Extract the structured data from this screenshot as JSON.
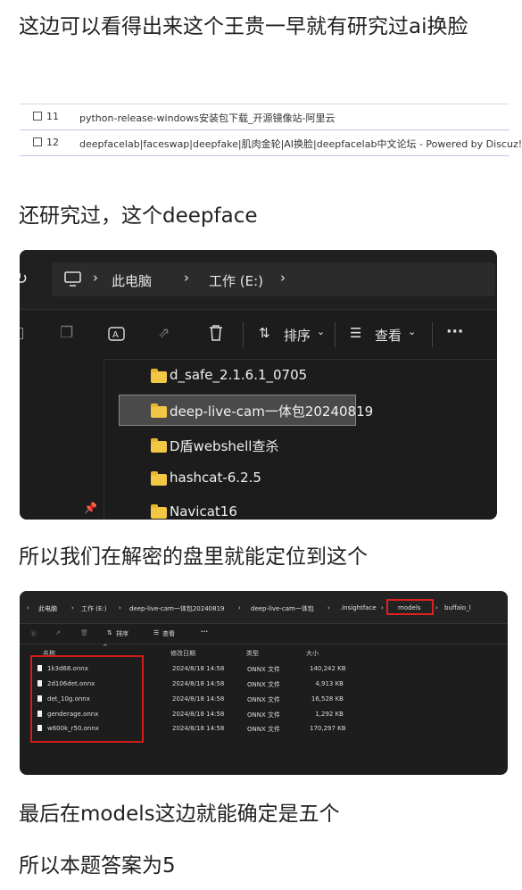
{
  "paragraphs": {
    "p1": "这边可以看得出来这个王贵一早就有研究过ai换脸",
    "p2": "还研究过，这个deepface",
    "p3": "所以我们在解密的盘里就能定位到这个",
    "p4": "最后在models这边就能确定是五个",
    "p5": "所以本题答案为5"
  },
  "history": [
    {
      "num": "11",
      "text": "python-release-windows安装包下载_开源镜像站-阿里云"
    },
    {
      "num": "12",
      "text": "deepfacelab|faceswap|deepfake|肌肉金轮|AI换脸|deepfacelab中文论坛 - Powered by Discuz!"
    }
  ],
  "explorer1": {
    "breadcrumb": [
      "此电脑",
      "工作 (E:)"
    ],
    "toolbar": {
      "sort": "排序",
      "view": "查看",
      "more": "···"
    },
    "folders": [
      "d_safe_2.1.6.1_0705",
      "deep-live-cam一体包20240819",
      "D盾webshell查杀",
      "hashcat-6.2.5",
      "Navicat16"
    ],
    "selected_index": 1
  },
  "explorer2": {
    "breadcrumb": [
      "此电脑",
      "工作 (E:)",
      "deep-live-cam一体包20240819",
      "deep-live-cam一体包",
      ".insightface",
      "models",
      "buffalo_l"
    ],
    "toolbar": {
      "sort": "排序",
      "view": "查看",
      "more": "···"
    },
    "columns": [
      "名称",
      "修改日期",
      "类型",
      "大小"
    ],
    "files": [
      {
        "name": "1k3d68.onnx",
        "date": "2024/8/18 14:58",
        "type": "ONNX 文件",
        "size": "140,242 KB"
      },
      {
        "name": "2d106det.onnx",
        "date": "2024/8/18 14:58",
        "type": "ONNX 文件",
        "size": "4,913 KB"
      },
      {
        "name": "det_10g.onnx",
        "date": "2024/8/18 14:58",
        "type": "ONNX 文件",
        "size": "16,528 KB"
      },
      {
        "name": "genderage.onnx",
        "date": "2024/8/18 14:58",
        "type": "ONNX 文件",
        "size": "1,292 KB"
      },
      {
        "name": "w600k_r50.onnx",
        "date": "2024/8/18 14:58",
        "type": "ONNX 文件",
        "size": "170,297 KB"
      }
    ]
  },
  "colors": {
    "highlight_red": "#d21c1c",
    "folder_yellow": "#f3c744",
    "dark_bg": "#1c1c1c"
  }
}
